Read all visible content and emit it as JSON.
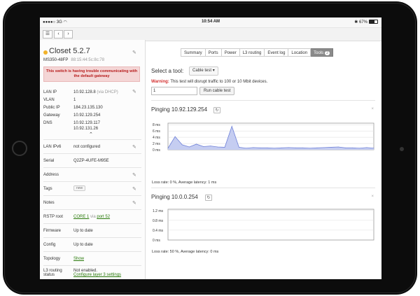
{
  "status_bar": {
    "carrier": "3G",
    "time": "10:54 AM",
    "battery": "67%",
    "battery_level": 0.67
  },
  "toolbar": {
    "menu_icon": "list-icon",
    "back_icon": "chevron-left-icon",
    "forward_icon": "chevron-right-icon"
  },
  "device": {
    "name": "Closet 5.2.7",
    "model": "MS350-48FP",
    "mac": "88:15:44:5c:8c:78",
    "status_color": "#f1b22a",
    "warning": "This switch is having trouble communicating with the default gateway"
  },
  "network": {
    "lan_ip_label": "LAN IP",
    "lan_ip": "10.92.128.8",
    "lan_ip_note": "(via DHCP)",
    "vlan_label": "VLAN",
    "vlan": "1",
    "public_ip_label": "Public IP",
    "public_ip": "184.23.135.130",
    "gateway_label": "Gateway",
    "gateway": "10.92.129.254",
    "dns_label": "DNS",
    "dns1": "10.92.129.117",
    "dns2": "10.92.131.26",
    "collapse_icon": "chevron-up-icon"
  },
  "lan_ipv6": {
    "label": "LAN IPv6",
    "value": "not configured"
  },
  "serial": {
    "label": "Serial",
    "value": "Q2ZP-4UFE-M95E"
  },
  "address": {
    "label": "Address"
  },
  "tags": {
    "label": "Tags",
    "button": "new"
  },
  "notes": {
    "label": "Notes"
  },
  "rstp": {
    "label": "RSTP root",
    "root": "CORE 1",
    "via": "via",
    "port": "port 52"
  },
  "firmware": {
    "label": "Firmware",
    "value": "Up to date"
  },
  "config": {
    "label": "Config",
    "value": "Up to date"
  },
  "topology": {
    "label": "Topology",
    "link": "Show"
  },
  "l3": {
    "label1": "L3 routing",
    "label2": "status",
    "value": "Not enabled.",
    "link": "Configure layer 3 settings"
  },
  "tabs": [
    {
      "label": "Summary"
    },
    {
      "label": "Ports"
    },
    {
      "label": "Power"
    },
    {
      "label": "L3 routing"
    },
    {
      "label": "Event log"
    },
    {
      "label": "Location"
    },
    {
      "label": "Tools",
      "badge": "2",
      "active": true
    }
  ],
  "tools": {
    "select_label": "Select a tool:",
    "selected_tool": "Cable test",
    "warning_prefix": "Warning:",
    "warning_text": "This test will disrupt traffic to 100 or 10 Mbit devices.",
    "port_value": "1",
    "run_button": "Run cable test"
  },
  "ping1": {
    "title": "Pinging 10.92.129.254",
    "close": "×",
    "stats": "Loss rate: 0 %, Average latency: 1 ms"
  },
  "ping2": {
    "title": "Pinging 10.0.0.254",
    "close": "×",
    "stats": "Loss rate: 50 %, Average latency: 0 ms"
  },
  "chart_data": [
    {
      "type": "area",
      "series": [
        {
          "values": [
            0.5,
            4.2,
            1.6,
            0.9,
            1.8,
            1.0,
            1.2,
            0.9,
            0.8,
            7.5,
            0.8,
            0.5,
            0.7,
            0.6,
            0.6,
            0.5,
            0.6,
            0.7,
            0.6,
            0.6,
            0.5,
            0.6,
            0.7,
            0.8,
            0.9,
            0.6,
            0.6,
            0.5,
            0.7,
            0.5
          ]
        }
      ],
      "yticks": [
        "0 ms",
        "2 ms",
        "4 ms",
        "6 ms",
        "8 ms"
      ],
      "ylim": [
        0,
        8.5
      ],
      "fill": "#c5cdf1",
      "stroke": "#6f81d8"
    },
    {
      "type": "area",
      "series": [
        {
          "values": []
        }
      ],
      "yticks": [
        "0 ms",
        "0.4 ms",
        "0.8 ms",
        "1.2 ms"
      ],
      "ylim": [
        0,
        1.25
      ]
    }
  ]
}
